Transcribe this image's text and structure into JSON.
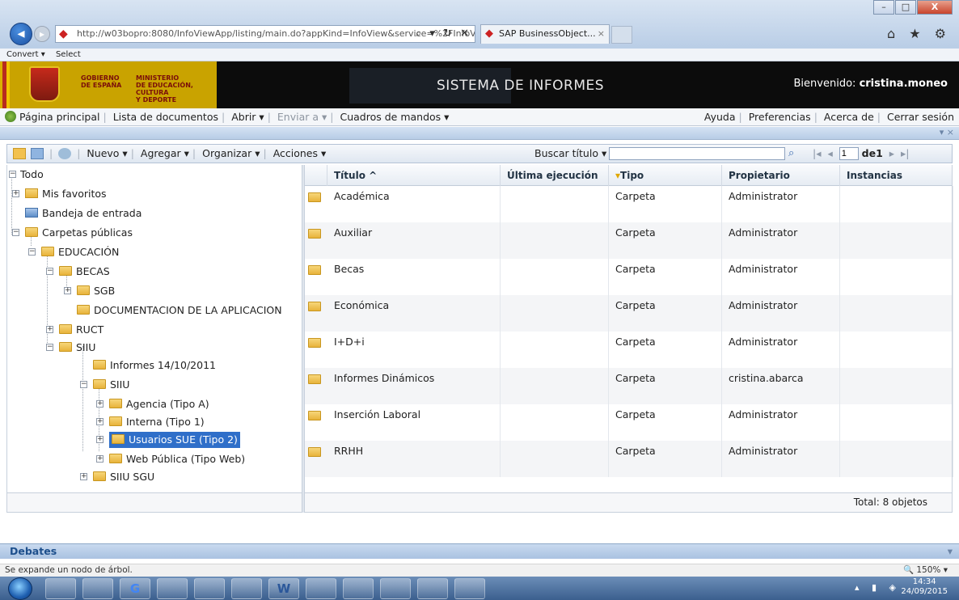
{
  "browser": {
    "address": "http://w03bopro:8080/InfoViewApp/listing/main.do?appKind=InfoView&service=%2FInfoVi",
    "address_tools": "⌕ ▾ ↻ ✕",
    "tab_title": "SAP BusinessObject...",
    "tab_close": "×",
    "window_controls": [
      "–",
      "□",
      "X"
    ],
    "right_icons": "⌂ ★ ⚙",
    "command_bar": [
      "Convert ▾",
      "Select"
    ]
  },
  "banner": {
    "gov_line1": "GOBIERNO",
    "gov_line2": "DE ESPAÑA",
    "ministry_line1": "MINISTERIO",
    "ministry_line2": "DE EDUCACIÓN, CULTURA",
    "ministry_line3": "Y DEPORTE",
    "title": "SISTEMA DE INFORMES",
    "welcome_label": "Bienvenido:",
    "user": "cristina.moneo"
  },
  "menu": {
    "home": "Página principal",
    "doc_list": "Lista de documentos",
    "open": "Abrir ▾",
    "send": "Enviar a ▾",
    "dashboards": "Cuadros de mandos ▾",
    "help": "Ayuda",
    "prefs": "Preferencias",
    "about": "Acerca de",
    "logout": "Cerrar sesión"
  },
  "toolbar": {
    "new": "Nuevo ▾",
    "add": "Agregar ▾",
    "organize": "Organizar ▾",
    "actions": "Acciones ▾",
    "search_label": "Buscar título ▾",
    "search_value": "",
    "page_value": "1",
    "of_label": "de1",
    "first": "|◂",
    "prev": "◂",
    "next": "▸",
    "last": "▸|"
  },
  "tree": {
    "root": "Todo",
    "favorites": "Mis favoritos",
    "inbox": "Bandeja de entrada",
    "public": "Carpetas públicas",
    "educacion": "EDUCACIÓN",
    "becas": "BECAS",
    "sgb": "SGB",
    "doc_app": "DOCUMENTACION DE LA APLICACION",
    "ruct": "RUCT",
    "siiu": "SIIU",
    "informes": "Informes 14/10/2011",
    "siiu2": "SIIU",
    "agencia": "Agencia (Tipo A)",
    "interna": "Interna (Tipo 1)",
    "usuarios": "Usuarios SUE (Tipo 2)",
    "web": "Web Pública (Tipo Web)",
    "siiu_sgu": "SIIU SGU"
  },
  "list": {
    "columns": {
      "title": "Título ^",
      "last_run": "Última ejecución",
      "type": "Tipo",
      "owner": "Propietario",
      "instances": "Instancias"
    },
    "rows": [
      {
        "title": "Académica",
        "last_run": "",
        "type": "Carpeta",
        "owner": "Administrator",
        "instances": ""
      },
      {
        "title": "Auxiliar",
        "last_run": "",
        "type": "Carpeta",
        "owner": "Administrator",
        "instances": ""
      },
      {
        "title": "Becas",
        "last_run": "",
        "type": "Carpeta",
        "owner": "Administrator",
        "instances": ""
      },
      {
        "title": "Económica",
        "last_run": "",
        "type": "Carpeta",
        "owner": "Administrator",
        "instances": ""
      },
      {
        "title": "I+D+i",
        "last_run": "",
        "type": "Carpeta",
        "owner": "Administrator",
        "instances": ""
      },
      {
        "title": "Informes Dinámicos",
        "last_run": "",
        "type": "Carpeta",
        "owner": "cristina.abarca",
        "instances": ""
      },
      {
        "title": "Inserción Laboral",
        "last_run": "",
        "type": "Carpeta",
        "owner": "Administrator",
        "instances": ""
      },
      {
        "title": "RRHH",
        "last_run": "",
        "type": "Carpeta",
        "owner": "Administrator",
        "instances": ""
      }
    ],
    "total": "Total: 8 objetos"
  },
  "debates": {
    "label": "Debates",
    "toggle": "▾"
  },
  "panel": {
    "controls": "▾ ×"
  },
  "status": {
    "message": "Se expande un nodo de árbol.",
    "zoom": "🔍 150% ▾"
  },
  "taskbar": {
    "apps": [
      "",
      "",
      "G",
      "",
      "",
      "",
      "W",
      "",
      "",
      "",
      "",
      ""
    ],
    "time": "14:34",
    "date": "24/09/2015",
    "tray": "▴ ▮ ◈"
  }
}
